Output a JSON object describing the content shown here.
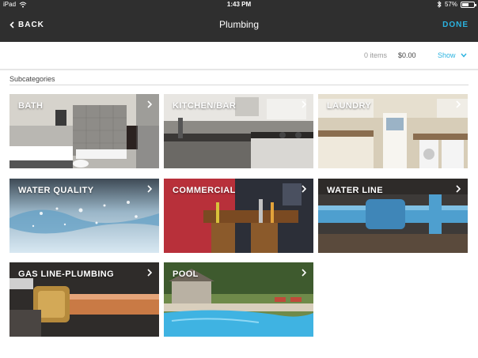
{
  "status_bar": {
    "device": "iPad",
    "time": "1:43 PM",
    "battery": "57%",
    "battery_level": 0.57
  },
  "nav": {
    "back_label": "BACK",
    "title": "Plumbing",
    "done_label": "DONE"
  },
  "summary": {
    "items_count": "0 items",
    "total": "$0.00",
    "show_label": "Show"
  },
  "subcategories": {
    "heading": "Subcategories",
    "tiles": [
      {
        "label": "BATH",
        "icon": "bath-photo"
      },
      {
        "label": "KITCHEN/BAR",
        "icon": "kitchen-photo"
      },
      {
        "label": "LAUNDRY",
        "icon": "laundry-photo"
      },
      {
        "label": "WATER QUALITY",
        "icon": "water-splash-photo"
      },
      {
        "label": "COMMERCIAL",
        "icon": "tool-belt-photo"
      },
      {
        "label": "WATER LINE",
        "icon": "blue-pipe-photo"
      },
      {
        "label": "GAS LINE-PLUMBING",
        "icon": "copper-pipe-photo"
      },
      {
        "label": "POOL",
        "icon": "pool-photo"
      }
    ]
  },
  "colors": {
    "nav_bg": "#2f2f2f",
    "accent": "#2bb3e0"
  }
}
